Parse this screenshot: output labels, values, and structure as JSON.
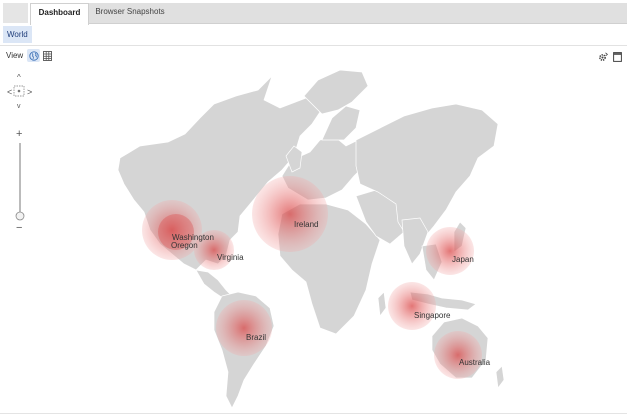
{
  "tabs": [
    {
      "label": "Dashboard",
      "active": true
    },
    {
      "label": "Browser Snapshots",
      "active": false
    }
  ],
  "subtab": {
    "label": "World"
  },
  "view": {
    "label": "View",
    "buttons": [
      {
        "icon": "globe-icon",
        "selected": true
      },
      {
        "icon": "table-icon",
        "selected": false
      }
    ]
  },
  "map_controls": {
    "zoom_in": "+",
    "zoom_out": "−",
    "pan_up": "^",
    "pan_down": "v",
    "pan_left": "<",
    "pan_right": ">"
  },
  "regions": [
    {
      "name": "Washington"
    },
    {
      "name": "Oregon"
    },
    {
      "name": "Virginia"
    },
    {
      "name": "Ireland"
    },
    {
      "name": "Japan"
    },
    {
      "name": "Singapore"
    },
    {
      "name": "Brazil"
    },
    {
      "name": "Australia"
    }
  ],
  "colors": {
    "bubble": "#e86a6a",
    "land": "#d5d5d5",
    "tab_strip": "#e0e0e0",
    "selected": "#dbe6f6"
  }
}
